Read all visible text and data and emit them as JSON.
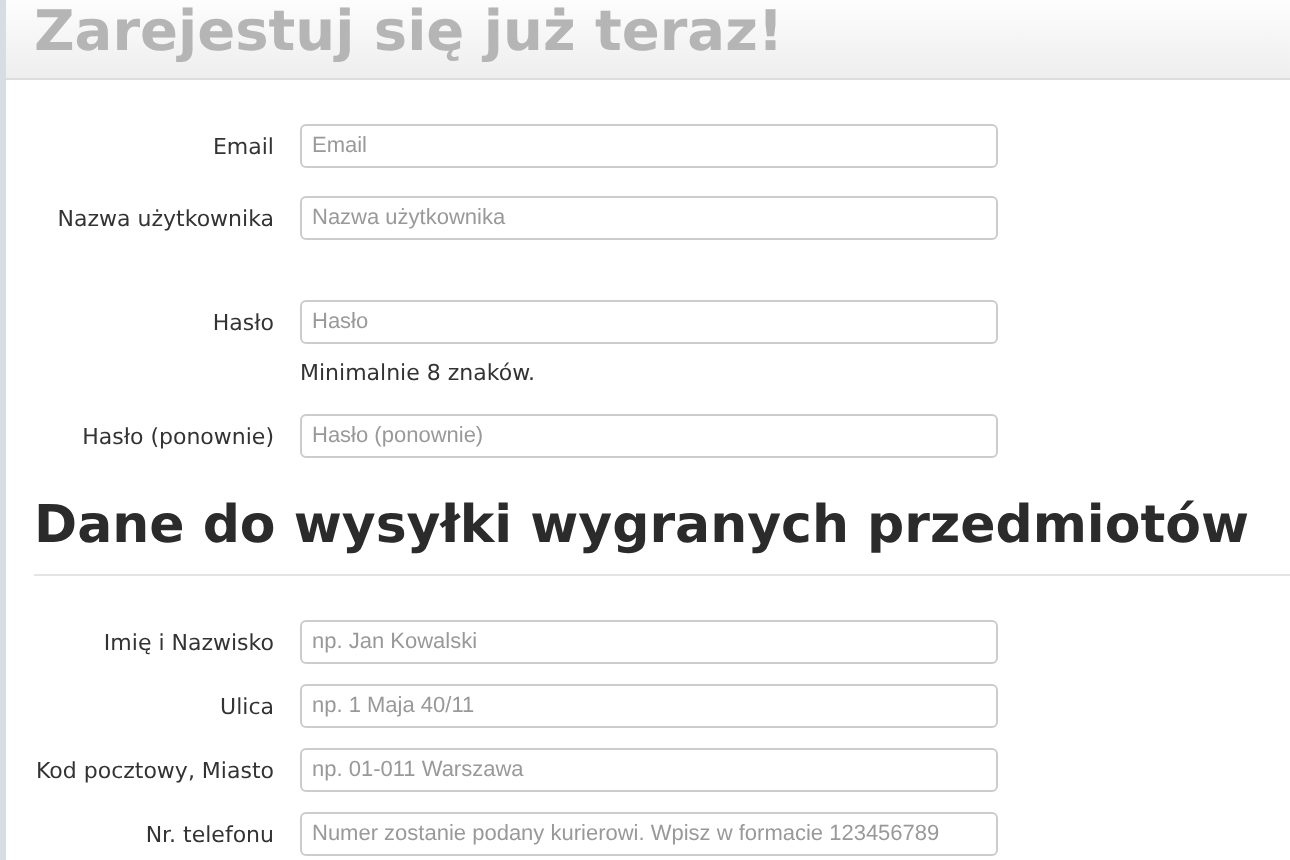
{
  "header": {
    "title": "Zarejestuj się już teraz!"
  },
  "account_fields": [
    {
      "label": "Email",
      "placeholder": "Email"
    },
    {
      "label": "Nazwa użytkownika",
      "placeholder": "Nazwa użytkownika"
    },
    {
      "label": "Hasło",
      "placeholder": "Hasło",
      "hint": "Minimalnie 8 znaków."
    },
    {
      "label": "Hasło (ponownie)",
      "placeholder": "Hasło (ponownie)"
    }
  ],
  "shipping": {
    "title": "Dane do wysyłki wygranych przedmiotów",
    "fields": [
      {
        "label": "Imię i Nazwisko",
        "placeholder": "np. Jan Kowalski"
      },
      {
        "label": "Ulica",
        "placeholder": "np. 1 Maja 40/11"
      },
      {
        "label": "Kod pocztowy, Miasto",
        "placeholder": "np. 01-011 Warszawa"
      },
      {
        "label": "Nr. telefonu",
        "placeholder": "Numer zostanie podany kurierowi. Wpisz w formacie 123456789"
      }
    ]
  }
}
